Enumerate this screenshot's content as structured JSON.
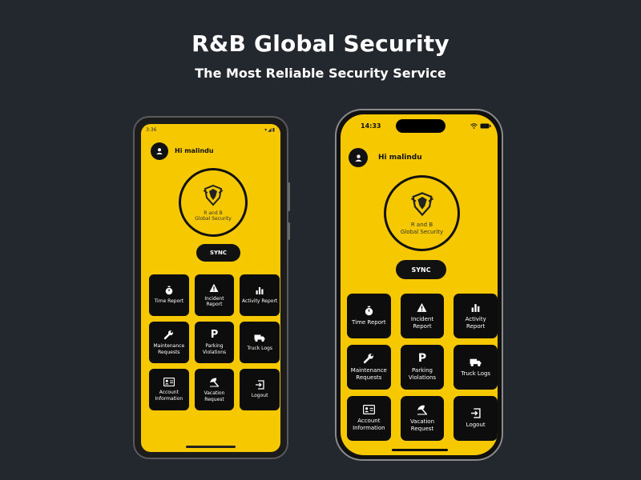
{
  "hero": {
    "title": "R&B Global Security",
    "subtitle": "The Most Reliable Security Service"
  },
  "colors": {
    "background": "#23272e",
    "app_yellow": "#f5c800",
    "tile": "#0d0d0d"
  },
  "android": {
    "status_time": "3:36",
    "greeting": "Hi malindu",
    "logo_line1": "R and B",
    "logo_line2": "Global Security",
    "sync_label": "SYNC",
    "tiles": [
      {
        "label": "Time Report",
        "icon": "timer-icon"
      },
      {
        "label": "Incident\nReport",
        "icon": "warning-icon"
      },
      {
        "label": "Activity Report",
        "icon": "bar-chart-icon"
      },
      {
        "label": "Maintenance\nRequests",
        "icon": "wrench-icon"
      },
      {
        "label": "Parking\nViolations",
        "icon": "parking-icon"
      },
      {
        "label": "Truck Logs",
        "icon": "truck-icon"
      },
      {
        "label": "Account\nInformation",
        "icon": "id-card-icon"
      },
      {
        "label": "Vacation\nRequest",
        "icon": "beach-umbrella-icon"
      },
      {
        "label": "Logout",
        "icon": "logout-icon"
      }
    ]
  },
  "iphone": {
    "status_time": "14:33",
    "greeting": "Hi malindu",
    "logo_line1": "R and B",
    "logo_line2": "Global Security",
    "sync_label": "SYNC",
    "tiles": [
      {
        "label": "Time Report",
        "icon": "timer-icon"
      },
      {
        "label": "Incident\nReport",
        "icon": "warning-icon"
      },
      {
        "label": "Activity\nReport",
        "icon": "bar-chart-icon"
      },
      {
        "label": "Maintenance\nRequests",
        "icon": "wrench-icon"
      },
      {
        "label": "Parking\nViolations",
        "icon": "parking-icon"
      },
      {
        "label": "Truck Logs",
        "icon": "truck-icon"
      },
      {
        "label": "Account\nInformation",
        "icon": "id-card-icon"
      },
      {
        "label": "Vacation\nRequest",
        "icon": "beach-umbrella-icon"
      },
      {
        "label": "Logout",
        "icon": "logout-icon"
      }
    ]
  }
}
